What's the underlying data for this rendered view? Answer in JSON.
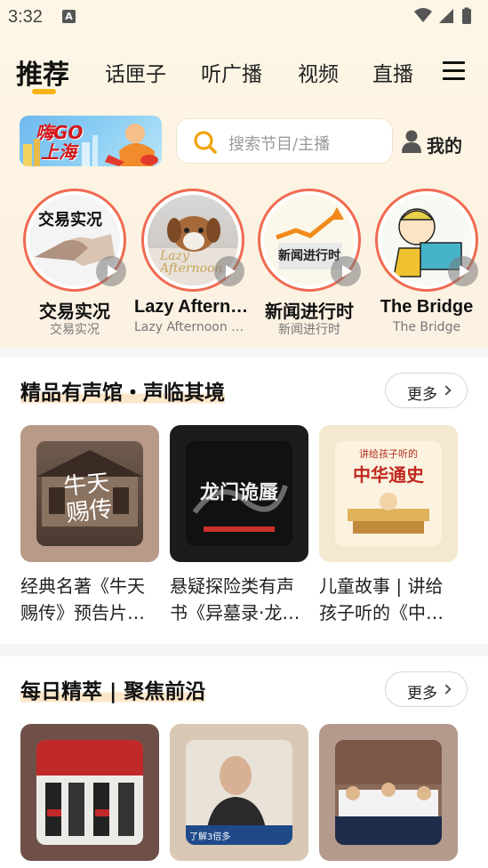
{
  "status_bar": {
    "time": "3:32",
    "notification_badge": "A"
  },
  "tabs": [
    {
      "label": "推荐",
      "active": true
    },
    {
      "label": "话匣子",
      "active": false
    },
    {
      "label": "听广播",
      "active": false
    },
    {
      "label": "视频",
      "active": false
    },
    {
      "label": "直播",
      "active": false
    }
  ],
  "banner": {
    "line1": "嗨GO",
    "line2": "上海"
  },
  "search": {
    "placeholder": "搜索节目/主播"
  },
  "mine": {
    "label": "我的"
  },
  "stations": [
    {
      "title": "交易实况",
      "subtitle": "交易实况",
      "art_text": "交易实况"
    },
    {
      "title": "Lazy Afternoon",
      "subtitle": "Lazy Afternoon Music",
      "art_text": "Lazy Afternoon"
    },
    {
      "title": "新闻进行时",
      "subtitle": "新闻进行时",
      "art_text": "新闻进行时"
    },
    {
      "title": "The Bridge",
      "subtitle": "The Bridge",
      "art_text": ""
    }
  ],
  "sections": [
    {
      "title": "精品有声馆・声临其境",
      "more_label": "更多",
      "cards": [
        {
          "text": "经典名著《牛天赐传》预告片来了",
          "art_text": "牛天赐传"
        },
        {
          "text": "悬疑探险类有声书《异墓录·龙门诡蜃》",
          "art_text": "龙门诡蜃"
        },
        {
          "text": "儿童故事 | 讲给孩子听的《中华通史》",
          "art_text": "中华通史",
          "art_top": "讲给孩子听的"
        }
      ]
    },
    {
      "title": "每日精萃 | 聚焦前沿",
      "more_label": "更多",
      "cards": [
        {
          "text": "",
          "art_text": ""
        },
        {
          "text": "",
          "art_text": "了解3倍多"
        },
        {
          "text": "",
          "art_text": ""
        }
      ]
    }
  ],
  "colors": {
    "accent_yellow": "#f6b318",
    "ring_red": "#f06b52",
    "header_bg": "#fdf6e6"
  }
}
